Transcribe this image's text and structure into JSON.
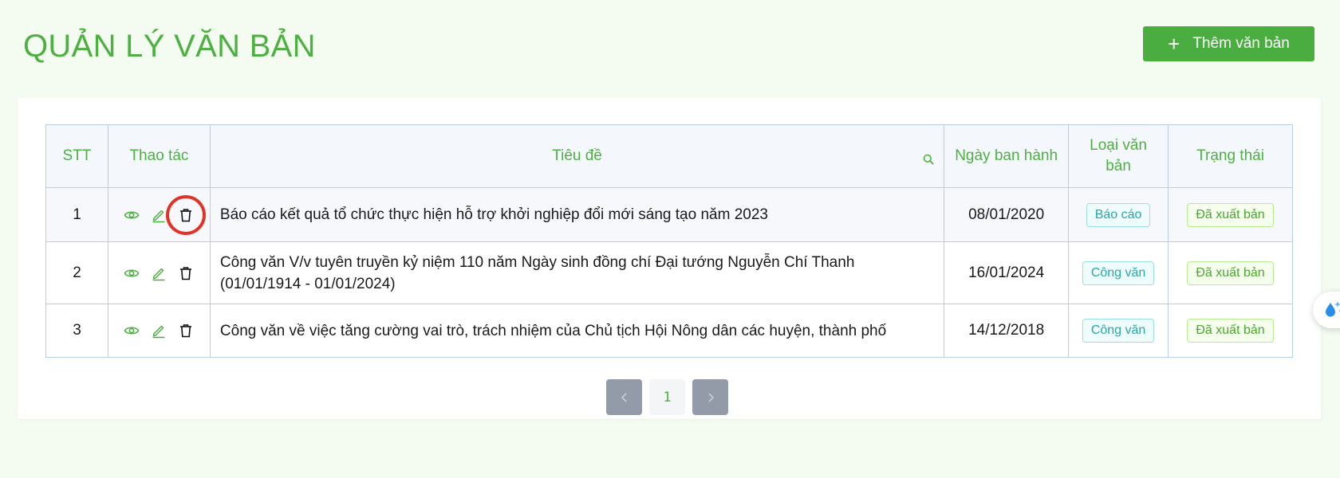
{
  "page": {
    "title": "QUẢN LÝ VĂN BẢN"
  },
  "toolbar": {
    "add_label": "Thêm văn bản"
  },
  "table": {
    "headers": {
      "stt": "STT",
      "actions": "Thao tác",
      "title": "Tiêu đề",
      "date": "Ngày ban hành",
      "type": "Loại văn bản",
      "status": "Trạng thái"
    },
    "rows": [
      {
        "stt": "1",
        "title": "Báo cáo kết quả tổ chức thực hiện hỗ trợ khởi nghiệp đổi mới sáng tạo năm 2023",
        "date": "08/01/2020",
        "type": "Báo cáo",
        "status": "Đã xuất bản"
      },
      {
        "stt": "2",
        "title": "Công văn V/v tuyên truyền kỷ niệm 110 năm Ngày sinh đồng chí Đại tướng Nguyễn Chí Thanh (01/01/1914 - 01/01/2024)",
        "date": "16/01/2024",
        "type": "Công văn",
        "status": "Đã xuất bản"
      },
      {
        "stt": "3",
        "title": "Công văn về việc tăng cường vai trò, trách nhiệm của Chủ tịch Hội Nông dân các huyện, thành phố",
        "date": "14/12/2018",
        "type": "Công văn",
        "status": "Đã xuất bản"
      }
    ]
  },
  "pagination": {
    "current": "1"
  },
  "colors": {
    "accent": "#4eb042",
    "highlight_ring": "#e0342a"
  },
  "icons": [
    "eye-icon",
    "edit-icon",
    "trash-icon",
    "search-icon",
    "plus-icon",
    "chevron-left-icon",
    "chevron-right-icon",
    "assistant-icon"
  ]
}
